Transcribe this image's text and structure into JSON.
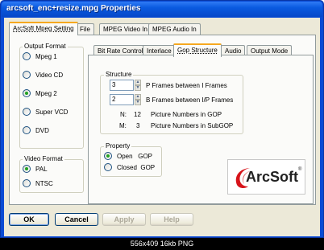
{
  "window": {
    "title": "arcsoft_enc+resize.mpg Properties"
  },
  "tabs": [
    {
      "label": "ArcSoft Mpeg Setting"
    },
    {
      "label": "File"
    },
    {
      "label": "MPEG Video In"
    },
    {
      "label": "MPEG Audio In"
    }
  ],
  "output_format": {
    "label": "Output Format",
    "options": [
      "Mpeg 1",
      "Video CD",
      "Mpeg 2",
      "Super VCD",
      "DVD"
    ],
    "selected": "Mpeg 2"
  },
  "video_format": {
    "label": "Video Format",
    "options": [
      "PAL",
      "NTSC"
    ],
    "selected": "PAL"
  },
  "subtabs": [
    {
      "label": "Bit Rate Control"
    },
    {
      "label": "Interlace"
    },
    {
      "label": "Gop Structure"
    },
    {
      "label": "Audio"
    },
    {
      "label": "Output Mode"
    }
  ],
  "structure": {
    "label": "Structure",
    "p_frames_value": "3",
    "p_frames_label": "P Frames between I Frames",
    "b_frames_value": "2",
    "b_frames_label": "B Frames between I/P Frames",
    "n_key": "N:",
    "n_value": "12",
    "n_label": "Picture Numbers in GOP",
    "m_key": "M:",
    "m_value": "3",
    "m_label": "Picture Numbers in SubGOP"
  },
  "property": {
    "label": "Property",
    "options": [
      "Open   GOP",
      "Closed  GOP"
    ],
    "selected": "Open   GOP"
  },
  "logo": {
    "text": "ArcSoft",
    "reg": "®"
  },
  "buttons": {
    "ok": "OK",
    "cancel": "Cancel",
    "apply": "Apply",
    "help": "Help"
  },
  "caption": "556x409  16kb  PNG",
  "colors": {
    "title_bar": "#0a5ae0",
    "dialog_bg": "#ece9d8",
    "tab_highlight": "#f6a81f",
    "radio_dot": "#21a121"
  }
}
